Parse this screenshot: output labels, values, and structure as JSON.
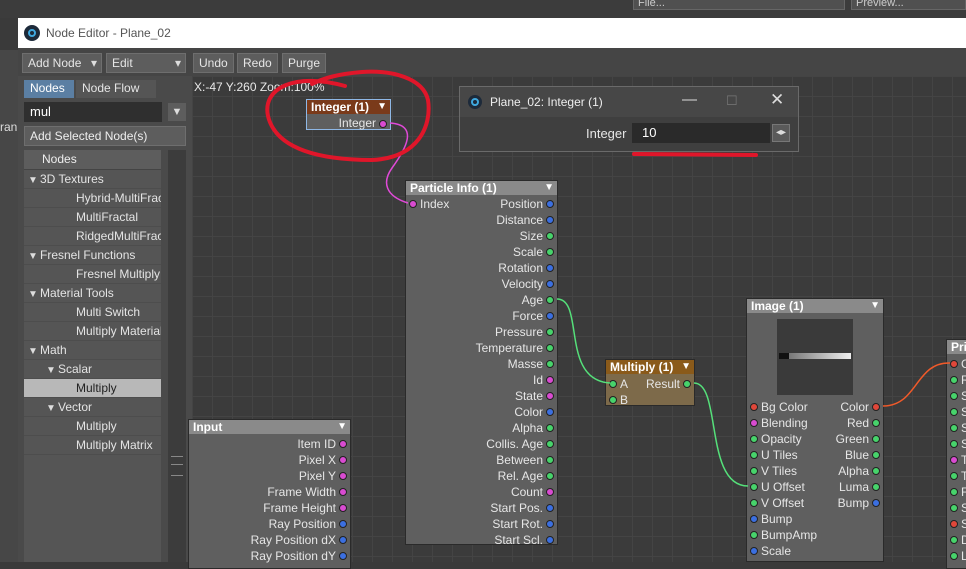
{
  "host": {
    "field_file": "File...",
    "field_preview": "Preview...",
    "left_stub": "ran"
  },
  "window": {
    "title": "Node Editor - Plane_02"
  },
  "toolbar": {
    "add_node": "Add Node",
    "edit": "Edit",
    "undo": "Undo",
    "redo": "Redo",
    "purge": "Purge"
  },
  "panel": {
    "tabs": [
      "Nodes",
      "Node Flow"
    ],
    "search_value": "mul",
    "add_selected": "Add Selected Node(s)",
    "tree_header": "Nodes",
    "tree": [
      {
        "label": "3D Textures",
        "level": 0,
        "expanded": true
      },
      {
        "label": "Hybrid-MultiFractal",
        "level": 2
      },
      {
        "label": "MultiFractal",
        "level": 2
      },
      {
        "label": "RidgedMultiFractal",
        "level": 2
      },
      {
        "label": "Fresnel Functions",
        "level": 0,
        "expanded": true
      },
      {
        "label": "Fresnel Multiply",
        "level": 2
      },
      {
        "label": "Material Tools",
        "level": 0,
        "expanded": true
      },
      {
        "label": "Multi Switch",
        "level": 2
      },
      {
        "label": "Multiply Material",
        "level": 2
      },
      {
        "label": "Math",
        "level": 0,
        "expanded": true
      },
      {
        "label": "Scalar",
        "level": 1,
        "expanded": true
      },
      {
        "label": "Multiply",
        "level": 2,
        "selected": true
      },
      {
        "label": "Vector",
        "level": 1,
        "expanded": true
      },
      {
        "label": "Multiply",
        "level": 2
      },
      {
        "label": "Multiply Matrix",
        "level": 2
      }
    ]
  },
  "canvas": {
    "coords": "X:-47 Y:260 Zoom:100%"
  },
  "nodes": {
    "integer": {
      "title": "Integer (1)",
      "output": "Integer"
    },
    "particle": {
      "title": "Particle Info (1)",
      "input": "Index",
      "outputs": [
        "Position",
        "Distance",
        "Size",
        "Scale",
        "Rotation",
        "Velocity",
        "Age",
        "Force",
        "Pressure",
        "Temperature",
        "Masse",
        "Id",
        "State",
        "Color",
        "Alpha",
        "Collis. Age",
        "Between",
        "Rel. Age",
        "Count",
        "Start Pos.",
        "Start Rot.",
        "Start Scl."
      ],
      "output_colors": [
        "b",
        "b",
        "g",
        "g",
        "b",
        "b",
        "g",
        "b",
        "g",
        "g",
        "g",
        "m",
        "m",
        "b",
        "g",
        "g",
        "g",
        "g",
        "m",
        "b",
        "b",
        "b"
      ]
    },
    "multiply": {
      "title": "Multiply (1)",
      "inputs": [
        "A",
        "B"
      ],
      "output": "Result"
    },
    "image": {
      "title": "Image (1)",
      "inputs": [
        "Bg Color",
        "Blending",
        "Opacity",
        "U Tiles",
        "V Tiles",
        "U Offset",
        "V Offset",
        "Bump",
        "BumpAmp",
        "Scale"
      ],
      "input_colors": [
        "r",
        "m",
        "g",
        "g",
        "g",
        "g",
        "g",
        "b",
        "g",
        "b"
      ],
      "outputs": [
        "Color",
        "Red",
        "Green",
        "Blue",
        "Alpha",
        "Luma",
        "Bump"
      ],
      "output_colors": [
        "r",
        "g",
        "g",
        "g",
        "g",
        "g",
        "b"
      ]
    },
    "input": {
      "title": "Input",
      "outputs": [
        "Item ID",
        "Pixel X",
        "Pixel Y",
        "Frame Width",
        "Frame Height",
        "Ray Position",
        "Ray Position dX",
        "Ray Position dY"
      ],
      "output_colors": [
        "m",
        "m",
        "m",
        "m",
        "m",
        "b",
        "b",
        "b"
      ]
    },
    "principled": {
      "title": "Prin",
      "inputs": [
        "C",
        "R",
        "S",
        "S",
        "S",
        "S",
        "T",
        "T",
        "F",
        "S",
        "S",
        "D",
        "L"
      ],
      "input_colors": [
        "r",
        "g",
        "g",
        "g",
        "g",
        "g",
        "m",
        "g",
        "g",
        "g",
        "r",
        "g",
        "g"
      ]
    }
  },
  "dialog": {
    "title": "Plane_02: Integer (1)",
    "label": "Integer",
    "value": "10"
  }
}
